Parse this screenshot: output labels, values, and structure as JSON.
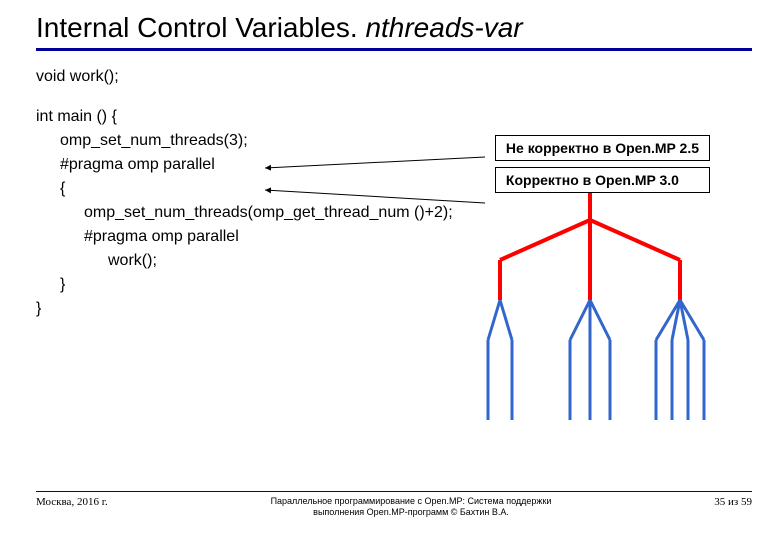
{
  "title_main": "Internal Control Variables. ",
  "title_italic": "nthreads-var",
  "code": {
    "l0": "void work();",
    "l1": "int main () {",
    "l2": "omp_set_num_threads(3);",
    "l3": "#pragma omp parallel",
    "l4": "{",
    "l5": "omp_set_num_threads(omp_get_thread_num ()+2);",
    "l6": "#pragma omp parallel",
    "l7": "work();",
    "l8": "}",
    "l9": "}"
  },
  "box1": "Не корректно в Open.MP 2.5",
  "box2": "Корректно в Open.MP 3.0",
  "footer": {
    "left": "Москва, 2016 г.",
    "center_l1": "Параллельное программирование с Open.MP: Система поддержки",
    "center_l2": "выполнения Open.MP-программ © Бахтин В.А.",
    "right": "35 из 59"
  }
}
